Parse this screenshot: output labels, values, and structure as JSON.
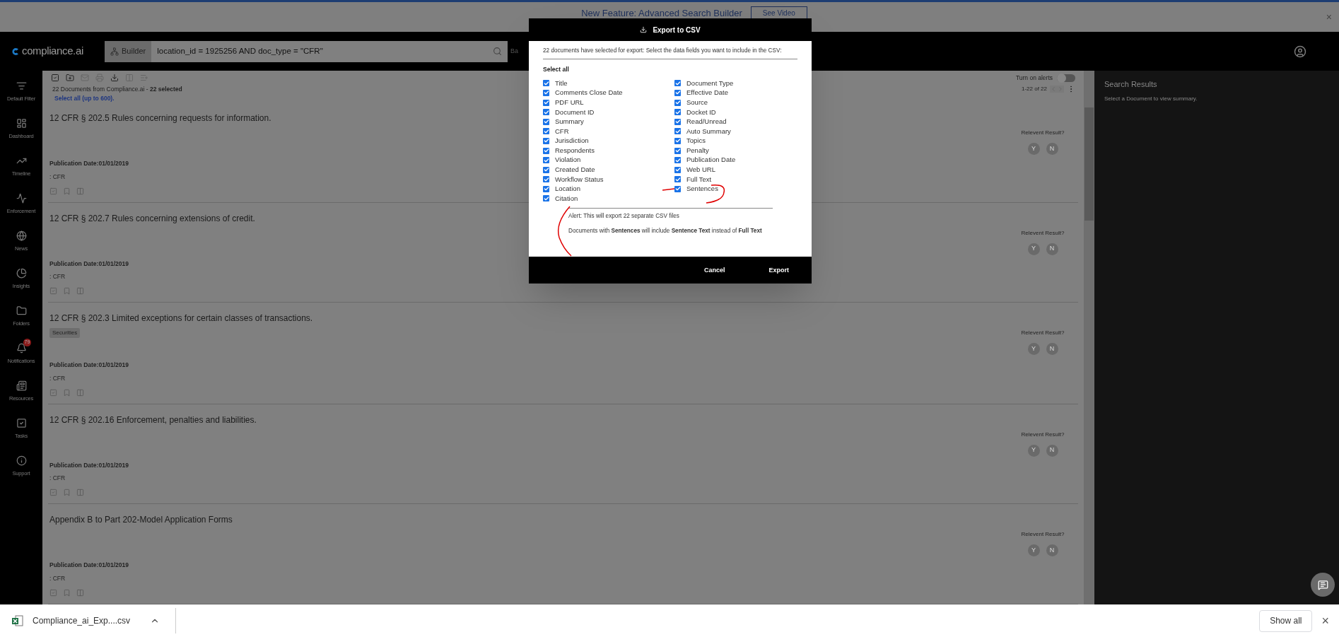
{
  "banner": {
    "text": "New Feature: Advanced Search Builder",
    "button": "See Video",
    "close": "×"
  },
  "header": {
    "logo": "compliance.ai",
    "builder_button": "Builder",
    "query": "location_id = 1925256 AND doc_type = \"CFR\"",
    "cut_text": "Ba"
  },
  "sidebar": {
    "items": [
      {
        "label": "Default Filter",
        "kind": "filter"
      },
      {
        "label": "Dashboard",
        "kind": "dashboard"
      },
      {
        "label": "Timeline",
        "kind": "timeline"
      },
      {
        "label": "Enforcement",
        "kind": "enforcement"
      },
      {
        "label": "News",
        "kind": "news"
      },
      {
        "label": "Insights",
        "kind": "insights"
      },
      {
        "label": "Folders",
        "kind": "folders"
      },
      {
        "label": "Notifications",
        "kind": "notifications",
        "badge": "79"
      },
      {
        "label": "Resources",
        "kind": "resources"
      },
      {
        "label": "Tasks",
        "kind": "tasks"
      },
      {
        "label": "Support",
        "kind": "support"
      }
    ]
  },
  "list": {
    "summary": "22 Documents from Compliance.ai - **22 selected**",
    "select_all_link": "Select all (up to 600).",
    "alerts_label": "Turn on alerts",
    "alerts_on": false,
    "pagination": "1-22 of 22"
  },
  "documents": [
    {
      "title": "12 CFR § 202.5 Rules concerning requests for information.",
      "publication_date_label": "Publication Date:",
      "publication_date": "01/01/2019",
      "source": ": CFR",
      "selected": true,
      "relevance_prompt": "Relevent Result?",
      "yes": "Y",
      "no": "N"
    },
    {
      "title": "12 CFR § 202.7 Rules concerning extensions of credit.",
      "publication_date_label": "Publication Date:",
      "publication_date": "01/01/2019",
      "source": ": CFR",
      "selected": true,
      "relevance_prompt": "Relevent Result?",
      "yes": "Y",
      "no": "N"
    },
    {
      "title": "12 CFR § 202.3 Limited exceptions for certain classes of transactions.",
      "tags": [
        "Securities"
      ],
      "publication_date_label": "Publication Date:",
      "publication_date": "01/01/2019",
      "source": ": CFR",
      "selected": true,
      "relevance_prompt": "Relevent Result?",
      "yes": "Y",
      "no": "N"
    },
    {
      "title": "12 CFR § 202.16 Enforcement, penalties and liabilities.",
      "publication_date_label": "Publication Date:",
      "publication_date": "01/01/2019",
      "source": ": CFR",
      "selected": true,
      "relevance_prompt": "Relevent Result?",
      "yes": "Y",
      "no": "N"
    },
    {
      "title": "Appendix B to Part 202-Model Application Forms",
      "publication_date_label": "Publication Date:",
      "publication_date": "01/01/2019",
      "source": ": CFR",
      "selected": true,
      "relevance_prompt": "Relevent Result?",
      "yes": "Y",
      "no": "N"
    }
  ],
  "search_results": {
    "title": "Search Results",
    "hint": "Select a Document to view summary."
  },
  "modal": {
    "title": "Export to CSV",
    "intro": "22 documents have selected for export: Select the data fields you want to include in the CSV:",
    "select_all": "Select all",
    "fields_left": [
      {
        "label": "Title",
        "checked": true
      },
      {
        "label": "Comments Close Date",
        "checked": true
      },
      {
        "label": "PDF URL",
        "checked": true
      },
      {
        "label": "Document ID",
        "checked": true
      },
      {
        "label": "Summary",
        "checked": true
      },
      {
        "label": "CFR",
        "checked": true
      },
      {
        "label": "Jurisdiction",
        "checked": true
      },
      {
        "label": "Respondents",
        "checked": true
      },
      {
        "label": "Violation",
        "checked": true
      },
      {
        "label": "Created Date",
        "checked": true
      },
      {
        "label": "Workflow Status",
        "checked": true
      },
      {
        "label": "Location",
        "checked": true
      },
      {
        "label": "Citation",
        "checked": true
      }
    ],
    "fields_right": [
      {
        "label": "Document Type",
        "checked": true
      },
      {
        "label": "Effective Date",
        "checked": true
      },
      {
        "label": "Source",
        "checked": true
      },
      {
        "label": "Docket ID",
        "checked": true
      },
      {
        "label": "Read/Unread",
        "checked": true
      },
      {
        "label": "Auto Summary",
        "checked": true
      },
      {
        "label": "Topics",
        "checked": true
      },
      {
        "label": "Penalty",
        "checked": true
      },
      {
        "label": "Publication Date",
        "checked": true
      },
      {
        "label": "Web URL",
        "checked": true
      },
      {
        "label": "Full Text",
        "checked": true
      },
      {
        "label": "Sentences",
        "checked": true
      }
    ],
    "alert": "Alert: This will export 22 separate CSV files",
    "note": "Documents with **Sentences** will include **Sentence Text** instead of **Full Text**",
    "cancel": "Cancel",
    "export": "Export"
  },
  "download_bar": {
    "file": "Compliance_ai_Exp....csv",
    "show_all": "Show all",
    "close": "×"
  }
}
